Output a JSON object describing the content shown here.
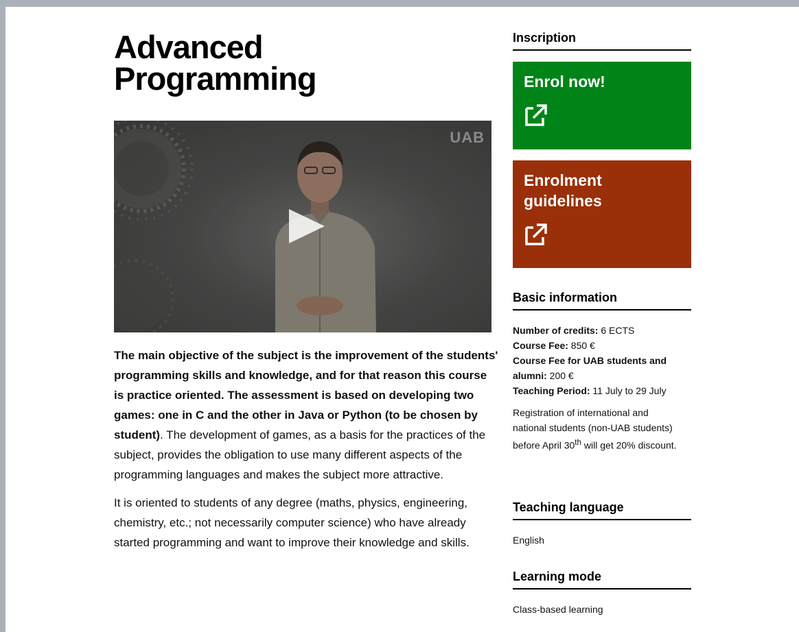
{
  "course": {
    "title_line1": "Advanced",
    "title_line2": "Programming"
  },
  "video": {
    "logo": "UAB",
    "play_icon": "play-icon"
  },
  "description": {
    "p1_bold": "The main objective of the subject is the improvement of the students' programming skills and knowledge, and for that reason this course is practice oriented. The assessment is based on developing two games: one in C and the other in Java or Python (to be chosen by student)",
    "p1_rest": ". The development of games, as a basis for the practices of the subject, provides the obligation to use many different aspects of the programming languages and makes the subject more attractive.",
    "p2": "It is oriented to students of any degree (maths, physics, engineering, chemistry, etc.; not necessarily computer science) who have already started programming and want to improve their knowledge and skills."
  },
  "sidebar": {
    "inscription_heading": "Inscription",
    "enrol": {
      "label": "Enrol now!",
      "color": "#008418",
      "icon": "external-link-icon"
    },
    "guidelines": {
      "label_line1": "Enrolment",
      "label_line2": "guidelines",
      "color": "#993009",
      "icon": "external-link-icon"
    },
    "basic_heading": "Basic information",
    "credits_label": "Number of credits:",
    "credits_value": " 6 ECTS",
    "fee_label": "Course Fee:",
    "fee_value": " 850 €",
    "fee_uab_label": "Course Fee for UAB students and alumni:",
    "fee_uab_value": " 200 €",
    "period_label": "Teaching Period:",
    "period_value": " 11 July to 29 July",
    "discount_pre": "Registration of international and national students (non-UAB students) before April 30",
    "discount_sup": "th",
    "discount_post": " will get 20% discount.",
    "language_heading": "Teaching language",
    "language_value": "English",
    "mode_heading": "Learning mode",
    "mode_value": "Class-based learning"
  }
}
